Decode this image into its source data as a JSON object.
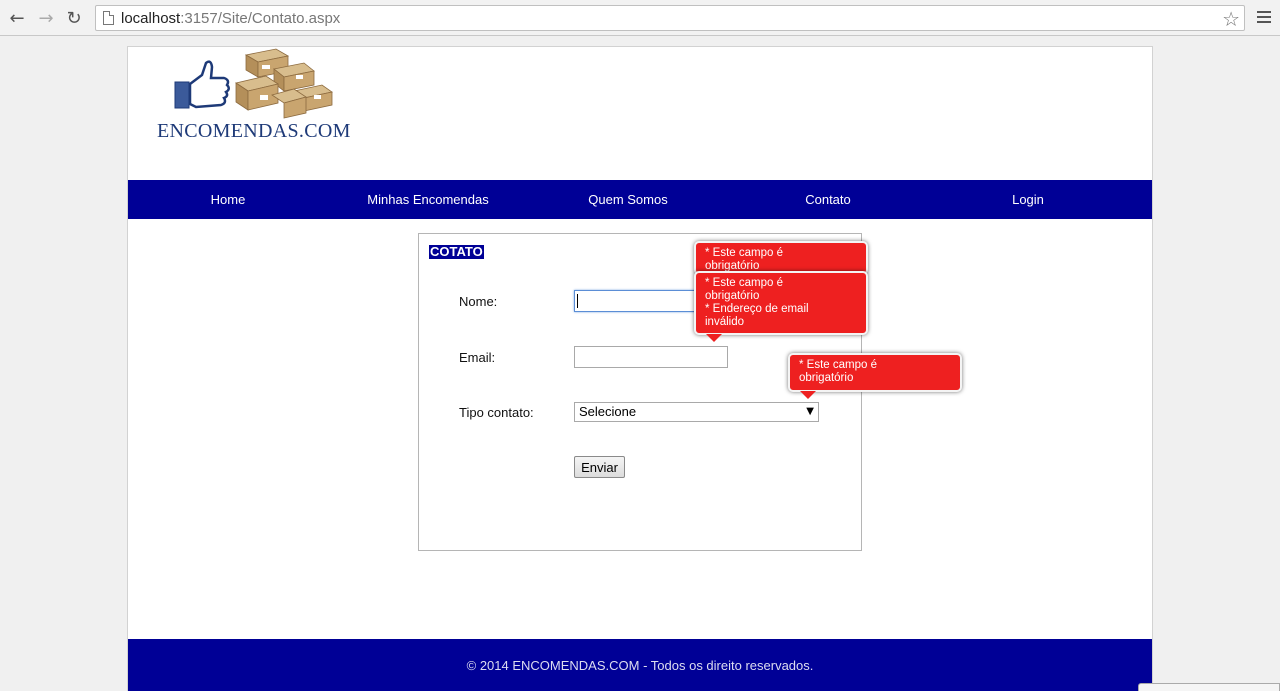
{
  "browser": {
    "url_host": "localhost",
    "url_rest": ":3157/Site/Contato.aspx",
    "back_icon": "arrow-left-icon",
    "forward_icon": "arrow-right-icon",
    "reload_icon": "reload-icon",
    "star_icon": "star-icon",
    "menu_icon": "hamburger-menu-icon"
  },
  "site": {
    "logo_text": "ENCOMENDAS.COM",
    "nav": [
      "Home",
      "Minhas Encomendas",
      "Quem Somos",
      "Contato",
      "Login"
    ]
  },
  "form": {
    "title": "COTATO",
    "name_label": "Nome:",
    "email_label": "Email:",
    "type_label": "Tipo contato:",
    "type_selected": "Selecione",
    "submit_label": "Enviar"
  },
  "tooltips": {
    "name_top": [
      "* Este campo é",
      "obrigatório"
    ],
    "email": [
      "* Este campo é",
      "obrigatório",
      "* Endereço de email",
      "inválido"
    ],
    "type": [
      "* Este campo é",
      "obrigatório"
    ]
  },
  "footer": {
    "text": "© 2014 ENCOMENDAS.COM - Todos os direito reservados."
  },
  "colors": {
    "nav_bg": "#000096",
    "tooltip_bg": "#ee2020"
  }
}
